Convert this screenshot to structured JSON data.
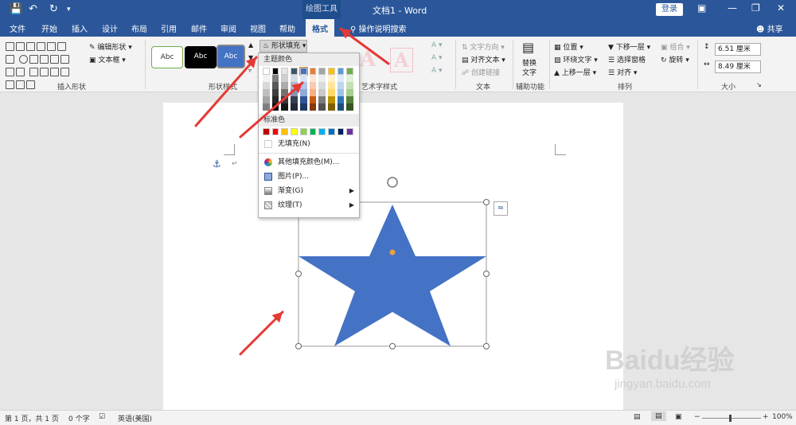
{
  "titlebar": {
    "contextual_tools": "绘图工具",
    "doc_title": "文档1 - Word",
    "login": "登录"
  },
  "tabs": {
    "file": "文件",
    "home": "开始",
    "insert": "插入",
    "design": "设计",
    "layout": "布局",
    "references": "引用",
    "mailings": "邮件",
    "review": "审阅",
    "view": "视图",
    "help": "帮助",
    "format": "格式",
    "tell_me": "操作说明搜索",
    "share": "共享"
  },
  "ribbon": {
    "edit_shape": "编辑形状",
    "text_box": "文本框",
    "insert_shapes_label": "插入形状",
    "style_sample": "Abc",
    "shape_styles_label": "形状样式",
    "shape_fill": "形状填充",
    "wordart_label": "艺术字样式",
    "text_direction": "文字方向",
    "align_text": "对齐文本",
    "create_link": "创建链接",
    "text_label": "文本",
    "alt_text_line1": "替换",
    "alt_text_line2": "文字",
    "accessibility_label": "辅助功能",
    "position": "位置",
    "wrap_text": "环绕文字",
    "bring_forward": "上移一层",
    "send_backward": "下移一层",
    "selection_pane": "选择窗格",
    "align": "对齐",
    "group": "组合",
    "rotate": "旋转",
    "arrange_label": "排列",
    "height": "6.51 厘米",
    "width": "8.49 厘米",
    "size_label": "大小"
  },
  "dropdown": {
    "theme_colors_label": "主题颜色",
    "theme_colors": [
      "#ffffff",
      "#000000",
      "#e7e6e6",
      "#44546a",
      "#4472c4",
      "#ed7d31",
      "#a5a5a5",
      "#ffc000",
      "#5b9bd5",
      "#70ad47"
    ],
    "theme_tints": [
      [
        "#f2f2f2",
        "#7f7f7f",
        "#d0cece",
        "#d6dce4",
        "#d9e2f3",
        "#fbe5d5",
        "#ededed",
        "#fff2cc",
        "#deebf6",
        "#e2efd9"
      ],
      [
        "#d8d8d8",
        "#595959",
        "#aeabab",
        "#adb9ca",
        "#b4c6e7",
        "#f7cbac",
        "#dbdbdb",
        "#fee599",
        "#bdd7ee",
        "#c5e0b3"
      ],
      [
        "#bfbfbf",
        "#3f3f3f",
        "#757070",
        "#8496b0",
        "#8eaadb",
        "#f4b183",
        "#c9c9c9",
        "#ffd966",
        "#9dc3e6",
        "#a8d08d"
      ],
      [
        "#a5a5a5",
        "#262626",
        "#3a3838",
        "#323f4f",
        "#2f5496",
        "#c55a11",
        "#7b7b7b",
        "#bf9000",
        "#2e75b5",
        "#538135"
      ],
      [
        "#7f7f7f",
        "#0c0c0c",
        "#171616",
        "#222a35",
        "#1f3864",
        "#833c0b",
        "#525252",
        "#7f6000",
        "#1e4e79",
        "#375623"
      ]
    ],
    "standard_colors_label": "标准色",
    "standard_colors": [
      "#c00000",
      "#ff0000",
      "#ffc000",
      "#ffff00",
      "#92d050",
      "#00b050",
      "#00b0f0",
      "#0070c0",
      "#002060",
      "#7030a0"
    ],
    "no_fill": "无填充(N)",
    "more_colors": "其他填充颜色(M)...",
    "picture": "图片(P)...",
    "gradient": "渐变(G)",
    "texture": "纹理(T)"
  },
  "shape": {
    "fill": "#4472c4",
    "handle_color": "#e8a33d"
  },
  "statusbar": {
    "page": "第 1 页，共 1 页",
    "words": "0 个字",
    "language": "英语(美国)",
    "zoom": "100%"
  },
  "watermark": {
    "brand": "Baidu经验",
    "url": "jingyan.baidu.com"
  },
  "colors": {
    "accent": "#2b579a",
    "arrow": "#e53935"
  }
}
